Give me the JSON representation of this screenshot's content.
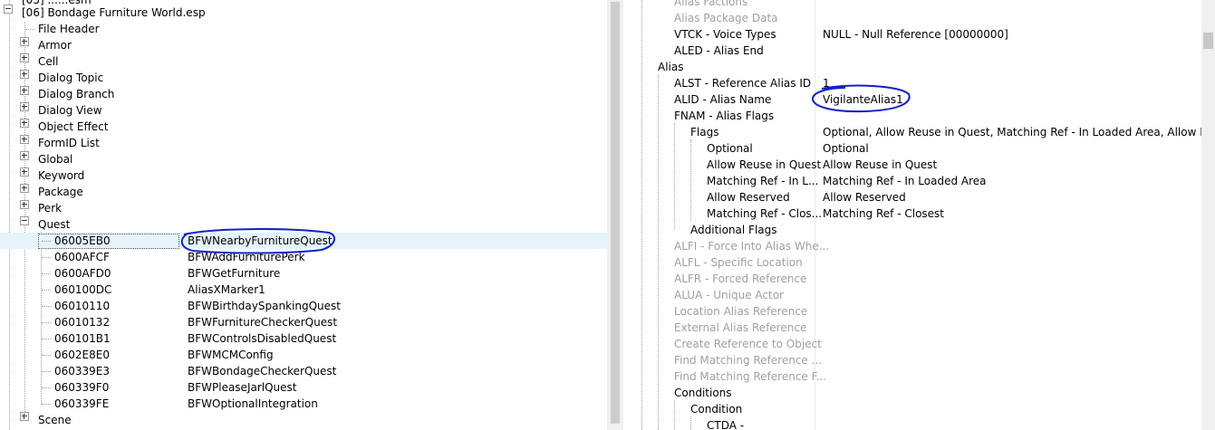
{
  "left_tree": {
    "plugin": "[06] Bondage Furniture World.esp",
    "items": [
      {
        "label": "File Header"
      },
      {
        "label": "Armor"
      },
      {
        "label": "Cell"
      },
      {
        "label": "Dialog Topic"
      },
      {
        "label": "Dialog Branch"
      },
      {
        "label": "Dialog View"
      },
      {
        "label": "Object Effect"
      },
      {
        "label": "FormID List"
      },
      {
        "label": "Global"
      },
      {
        "label": "Keyword"
      },
      {
        "label": "Package"
      },
      {
        "label": "Perk"
      },
      {
        "label": "Quest"
      },
      {
        "label": "Scene"
      }
    ],
    "quests": [
      {
        "formid": "06005EB0",
        "editor_id": "BFWNearbyFurnitureQuest"
      },
      {
        "formid": "0600AFCF",
        "editor_id": "BFWAddFurniturePerk"
      },
      {
        "formid": "0600AFD0",
        "editor_id": "BFWGetFurniture"
      },
      {
        "formid": "060100DC",
        "editor_id": "AliasXMarker1"
      },
      {
        "formid": "06010110",
        "editor_id": "BFWBirthdaySpankingQuest"
      },
      {
        "formid": "06010132",
        "editor_id": "BFWFurnitureCheckerQuest"
      },
      {
        "formid": "060101B1",
        "editor_id": "BFWControlsDisabledQuest"
      },
      {
        "formid": "0602E8E0",
        "editor_id": "BFWMCMConfig"
      },
      {
        "formid": "060339E3",
        "editor_id": "BFWBondageCheckerQuest"
      },
      {
        "formid": "060339F0",
        "editor_id": "BFWPleaseJarlQuest"
      },
      {
        "formid": "060339FE",
        "editor_id": "BFWOptionalIntegration"
      }
    ]
  },
  "right_tree": {
    "rows": [
      {
        "label": "Alias Factions",
        "value": ""
      },
      {
        "label": "Alias Package Data",
        "value": ""
      },
      {
        "label": "VTCK - Voice Types",
        "value": "NULL - Null Reference [00000000]"
      },
      {
        "label": "ALED - Alias End",
        "value": ""
      },
      {
        "label": "Alias",
        "value": ""
      },
      {
        "label": "ALST - Reference Alias ID",
        "value": "1"
      },
      {
        "label": "ALID - Alias Name",
        "value": "VigilanteAlias1"
      },
      {
        "label": "FNAM - Alias Flags",
        "value": ""
      },
      {
        "label": "Flags",
        "value": "Optional, Allow Reuse in Quest, Matching Ref - In Loaded Area, Allow Reserv..."
      },
      {
        "label": "Optional",
        "value": "Optional"
      },
      {
        "label": "Allow Reuse in Quest",
        "value": "Allow Reuse in Quest"
      },
      {
        "label": "Matching Ref - In L...",
        "value": "Matching Ref - In Loaded Area"
      },
      {
        "label": "Allow Reserved",
        "value": "Allow Reserved"
      },
      {
        "label": "Matching Ref - Clos...",
        "value": "Matching Ref - Closest"
      },
      {
        "label": "Additional Flags",
        "value": ""
      },
      {
        "label": "ALFI - Force Into Alias Whe...",
        "value": ""
      },
      {
        "label": "ALFL - Specific Location",
        "value": ""
      },
      {
        "label": "ALFR - Forced Reference",
        "value": ""
      },
      {
        "label": "ALUA - Unique Actor",
        "value": ""
      },
      {
        "label": "Location Alias Reference",
        "value": ""
      },
      {
        "label": "External Alias Reference",
        "value": ""
      },
      {
        "label": "Create Reference to Object",
        "value": ""
      },
      {
        "label": "Find Matching Reference ...",
        "value": ""
      },
      {
        "label": "Find Matching Reference F...",
        "value": ""
      },
      {
        "label": "Conditions",
        "value": ""
      },
      {
        "label": "Condition",
        "value": ""
      },
      {
        "label": "CTDA -",
        "value": ""
      }
    ]
  },
  "colors": {
    "selected_row": "#e5f3fb",
    "disabled_text": "#a0a0a0",
    "annotation_ink": "#1020c8"
  }
}
